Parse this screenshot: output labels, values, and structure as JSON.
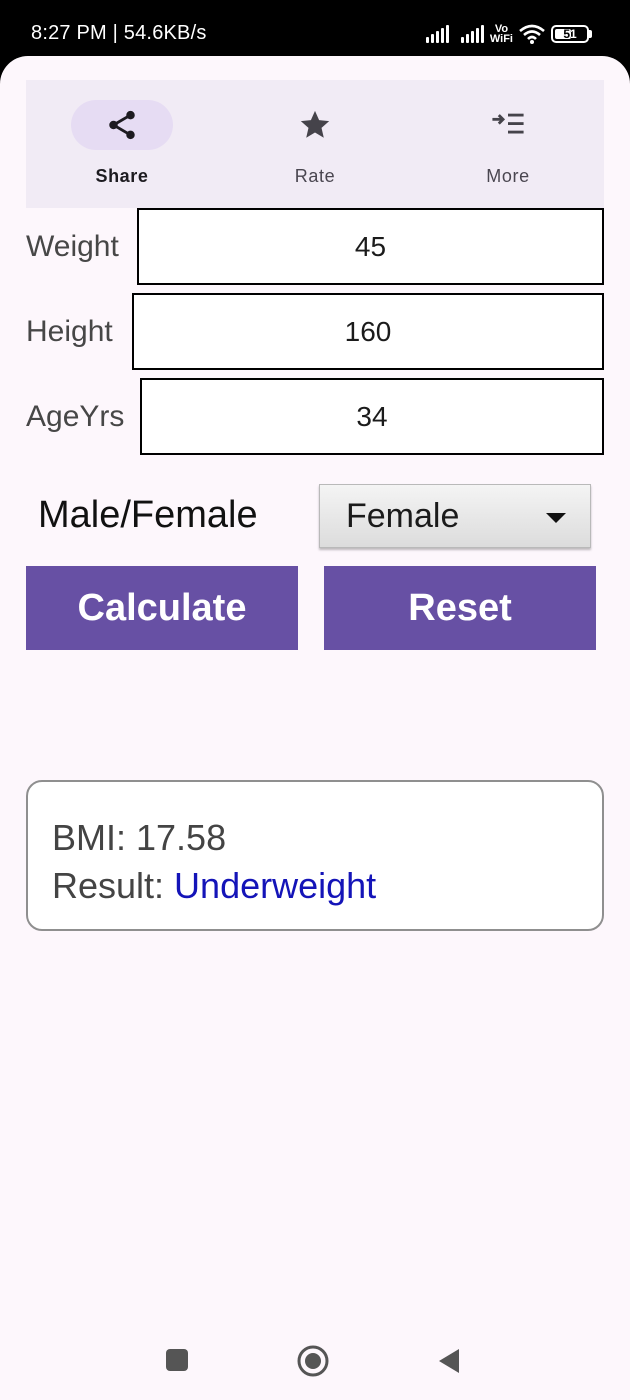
{
  "status_bar": {
    "time": "8:27 PM | 54.6KB/s",
    "vowifi_top": "Vo",
    "vowifi_bottom": "WiFi",
    "battery": "51"
  },
  "toolbar": {
    "items": [
      {
        "label": "Share",
        "icon": "share-icon",
        "active": true
      },
      {
        "label": "Rate",
        "icon": "star-icon",
        "active": false
      },
      {
        "label": "More",
        "icon": "more-list-icon",
        "active": false
      }
    ]
  },
  "form": {
    "weight": {
      "label": "Weight",
      "value": "45"
    },
    "height": {
      "label": "Height",
      "value": "160"
    },
    "age": {
      "label": "AgeYrs",
      "value": "34"
    },
    "gender": {
      "label": "Male/Female",
      "selected": "Female"
    }
  },
  "buttons": {
    "calculate": "Calculate",
    "reset": "Reset"
  },
  "result": {
    "bmi_prefix": "BMI: ",
    "bmi_value": "17.58",
    "result_prefix": "Result: ",
    "result_value": "Underweight"
  },
  "colors": {
    "accent": "#6750a4",
    "result_text": "#1414b8",
    "background": "#fdf7fc",
    "toolbar": "#f1ebf5"
  },
  "system_nav": [
    "recents-square-icon",
    "home-circle-icon",
    "back-triangle-icon"
  ]
}
